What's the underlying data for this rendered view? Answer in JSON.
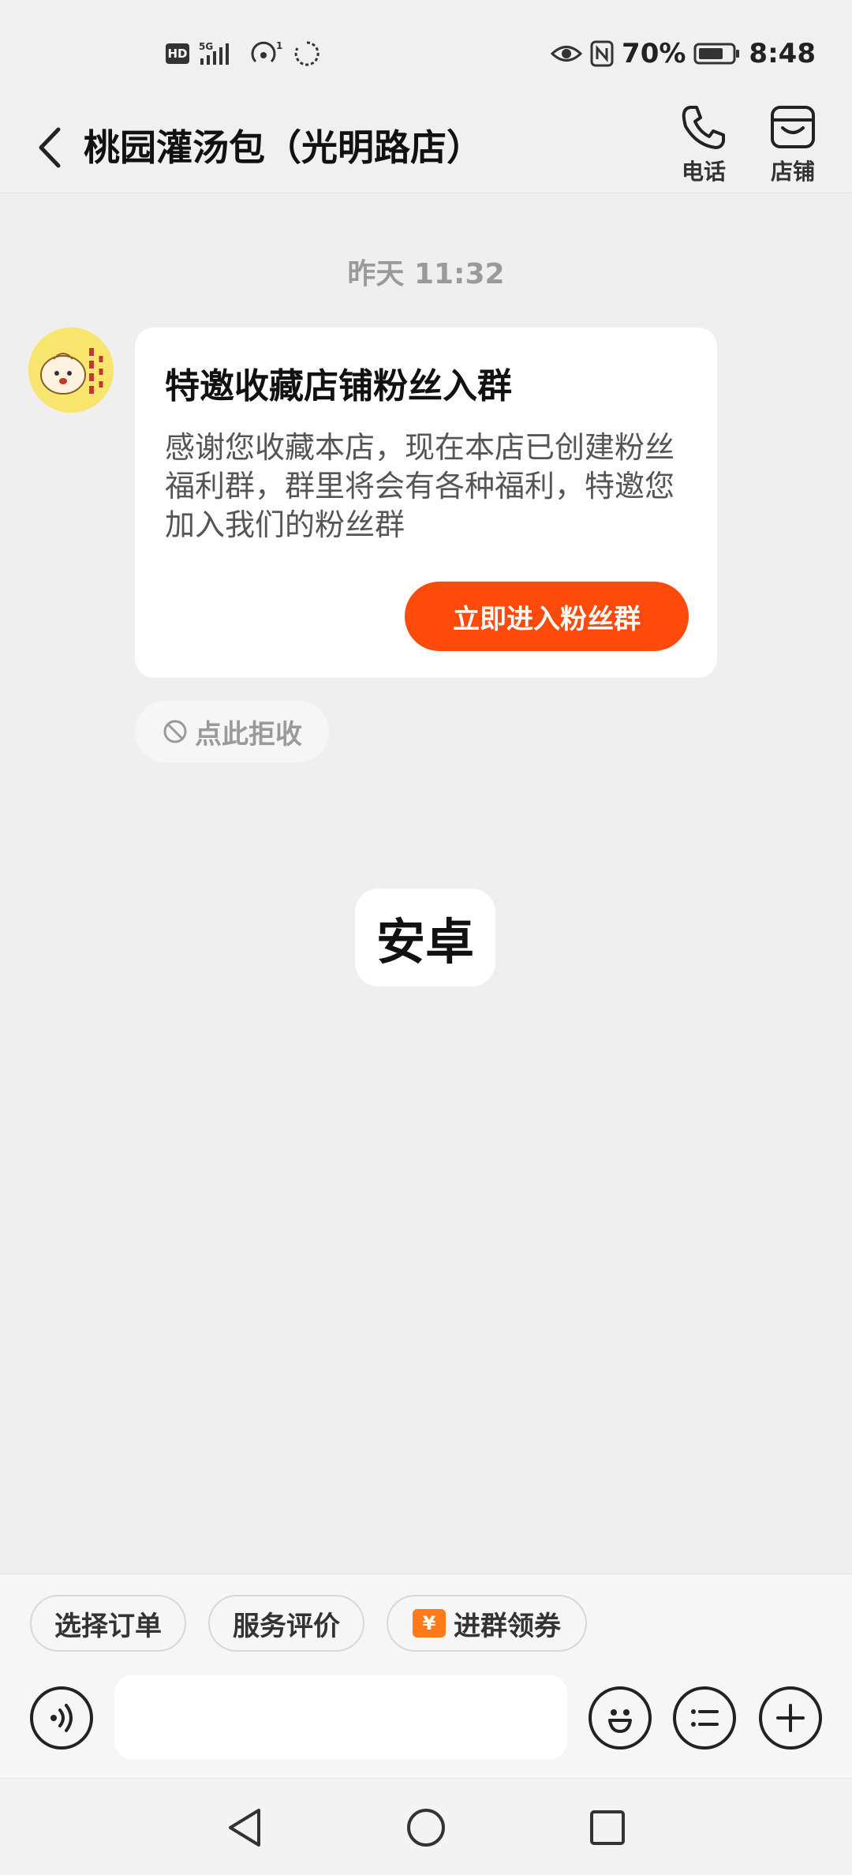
{
  "status_bar": {
    "network_badge": "HD",
    "signal_tag": "5G",
    "hotspot_tag": "1",
    "battery_percent": "70%",
    "time": "8:48",
    "icons": [
      "hd-icon",
      "signal-5g-icon",
      "hotspot-icon",
      "loading-icon",
      "eye-icon",
      "nfc-icon",
      "battery-icon"
    ]
  },
  "header": {
    "title": "桃园灌汤包（光明路店）",
    "phone_label": "电话",
    "store_label": "店铺"
  },
  "chat": {
    "timestamp": "昨天 11:32",
    "card": {
      "title": "特邀收藏店铺粉丝入群",
      "body": "感谢您收藏本店，现在本店已创建粉丝福利群，群里将会有各种福利，特邀您加入我们的粉丝群",
      "button_label": "立即进入粉丝群"
    },
    "reject_label": "点此拒收",
    "toast_text": "安卓"
  },
  "quick_actions": [
    {
      "label": "选择订单"
    },
    {
      "label": "服务评价"
    },
    {
      "label": "进群领券",
      "icon": "coupon-icon",
      "icon_glyph": "¥"
    }
  ],
  "input": {
    "value": "",
    "placeholder": ""
  },
  "colors": {
    "accent": "#fe4a0a",
    "background": "#efefef",
    "card": "#ffffff",
    "coupon": "#ff7a1a"
  }
}
